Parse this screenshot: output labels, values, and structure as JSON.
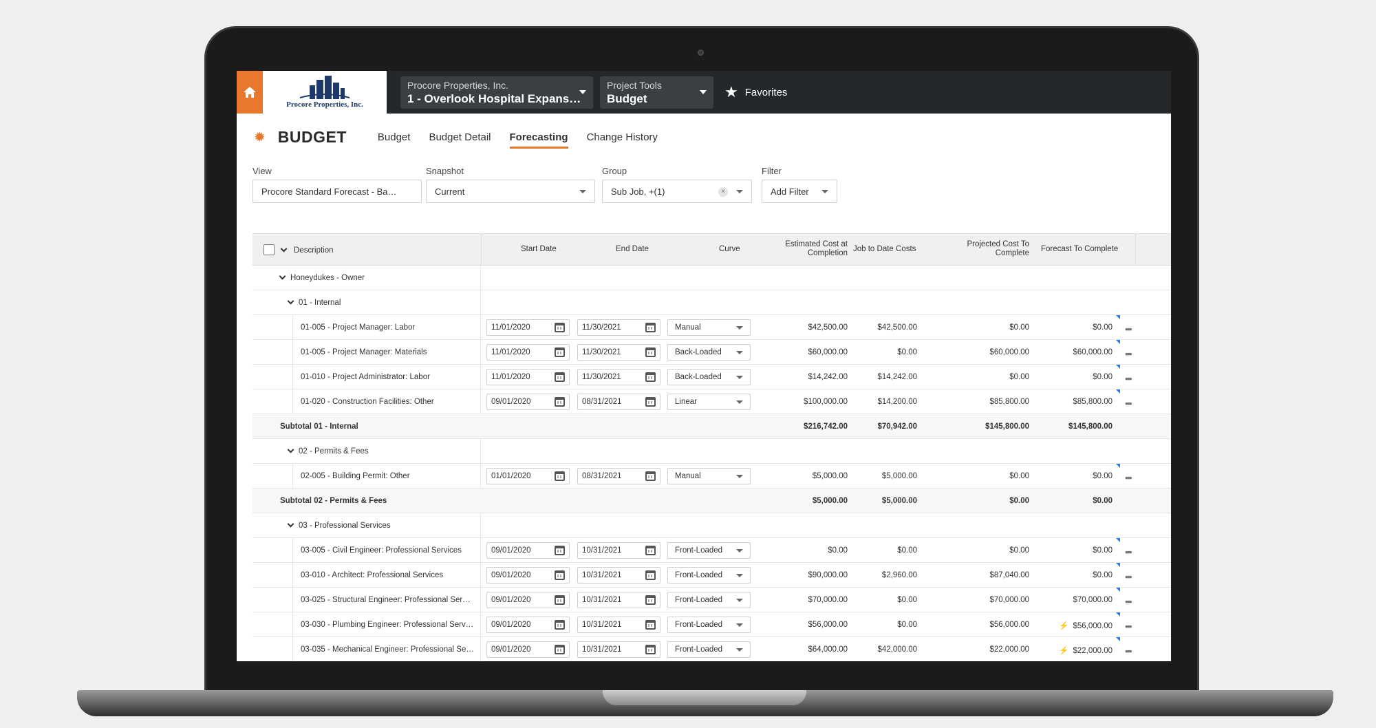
{
  "nav": {
    "company_logo_text": "Procore Properties, Inc.",
    "company": "Procore Properties, Inc.",
    "project": "1 - Overlook Hospital Expans…",
    "tools_label": "Project Tools",
    "tool": "Budget",
    "favorites": "Favorites"
  },
  "page": {
    "title": "BUDGET",
    "tabs": [
      "Budget",
      "Budget Detail",
      "Forecasting",
      "Change History"
    ],
    "active_tab": "Forecasting"
  },
  "filters": {
    "view_label": "View",
    "view_value": "Procore Standard Forecast - Ba…",
    "snapshot_label": "Snapshot",
    "snapshot_value": "Current",
    "group_label": "Group",
    "group_value": "Sub Job, +(1)",
    "filter_label": "Filter",
    "filter_value": "Add Filter"
  },
  "table": {
    "headers": {
      "description": "Description",
      "start": "Start Date",
      "end": "End Date",
      "curve": "Curve",
      "est_line1": "Estimated Cost at",
      "est_line2": "Completion",
      "jtd": "Job to Date Costs",
      "proj_line1": "Projected Cost To",
      "proj_line2": "Complete",
      "ftc": "Forecast To Complete"
    },
    "groups": {
      "owner": "Honeydukes - Owner",
      "g1": "01 - Internal",
      "g2": "02 - Permits & Fees",
      "g3": "03 - Professional Services"
    },
    "rows": [
      {
        "desc": "01-005 - Project Manager: Labor",
        "start": "11/01/2020",
        "end": "11/30/2021",
        "curve": "Manual",
        "est": "$42,500.00",
        "jtd": "$42,500.00",
        "proj": "$0.00",
        "ftc": "$0.00",
        "bolt": ""
      },
      {
        "desc": "01-005 - Project Manager: Materials",
        "start": "11/01/2020",
        "end": "11/30/2021",
        "curve": "Back-Loaded",
        "est": "$60,000.00",
        "jtd": "$0.00",
        "proj": "$60,000.00",
        "ftc": "$60,000.00",
        "bolt": ""
      },
      {
        "desc": "01-010 - Project Administrator: Labor",
        "start": "11/01/2020",
        "end": "11/30/2021",
        "curve": "Back-Loaded",
        "est": "$14,242.00",
        "jtd": "$14,242.00",
        "proj": "$0.00",
        "ftc": "$0.00",
        "bolt": ""
      },
      {
        "desc": "01-020 - Construction Facilities: Other",
        "start": "09/01/2020",
        "end": "08/31/2021",
        "curve": "Linear",
        "est": "$100,000.00",
        "jtd": "$14,200.00",
        "proj": "$85,800.00",
        "ftc": "$85,800.00",
        "bolt": ""
      },
      {
        "desc": "02-005 - Building Permit: Other",
        "start": "01/01/2020",
        "end": "08/31/2021",
        "curve": "Manual",
        "est": "$5,000.00",
        "jtd": "$5,000.00",
        "proj": "$0.00",
        "ftc": "$0.00",
        "bolt": ""
      },
      {
        "desc": "03-005 - Civil Engineer: Professional Services",
        "start": "09/01/2020",
        "end": "10/31/2021",
        "curve": "Front-Loaded",
        "est": "$0.00",
        "jtd": "$0.00",
        "proj": "$0.00",
        "ftc": "$0.00",
        "bolt": ""
      },
      {
        "desc": "03-010 - Architect: Professional Services",
        "start": "09/01/2020",
        "end": "10/31/2021",
        "curve": "Front-Loaded",
        "est": "$90,000.00",
        "jtd": "$2,960.00",
        "proj": "$87,040.00",
        "ftc": "$0.00",
        "bolt": ""
      },
      {
        "desc": "03-025 - Structural Engineer: Professional Ser…",
        "start": "09/01/2020",
        "end": "10/31/2021",
        "curve": "Front-Loaded",
        "est": "$70,000.00",
        "jtd": "$0.00",
        "proj": "$70,000.00",
        "ftc": "$70,000.00",
        "bolt": ""
      },
      {
        "desc": "03-030 - Plumbing Engineer: Professional Serv…",
        "start": "09/01/2020",
        "end": "10/31/2021",
        "curve": "Front-Loaded",
        "est": "$56,000.00",
        "jtd": "$0.00",
        "proj": "$56,000.00",
        "ftc": "$56,000.00",
        "bolt": "⚡"
      },
      {
        "desc": "03-035 - Mechanical Engineer: Professional Se…",
        "start": "09/01/2020",
        "end": "10/31/2021",
        "curve": "Front-Loaded",
        "est": "$64,000.00",
        "jtd": "$42,000.00",
        "proj": "$22,000.00",
        "ftc": "$22,000.00",
        "bolt": "⚡"
      }
    ],
    "subtotals": [
      {
        "label": "Subtotal 01 - Internal",
        "est": "$216,742.00",
        "jtd": "$70,942.00",
        "proj": "$145,800.00",
        "ftc": "$145,800.00"
      },
      {
        "label": "Subtotal 02 - Permits & Fees",
        "est": "$5,000.00",
        "jtd": "$5,000.00",
        "proj": "$0.00",
        "ftc": "$0.00"
      }
    ]
  },
  "colors": {
    "accent": "#e8782c",
    "nav_bg": "#25282b",
    "flag": "#2b7de0"
  }
}
